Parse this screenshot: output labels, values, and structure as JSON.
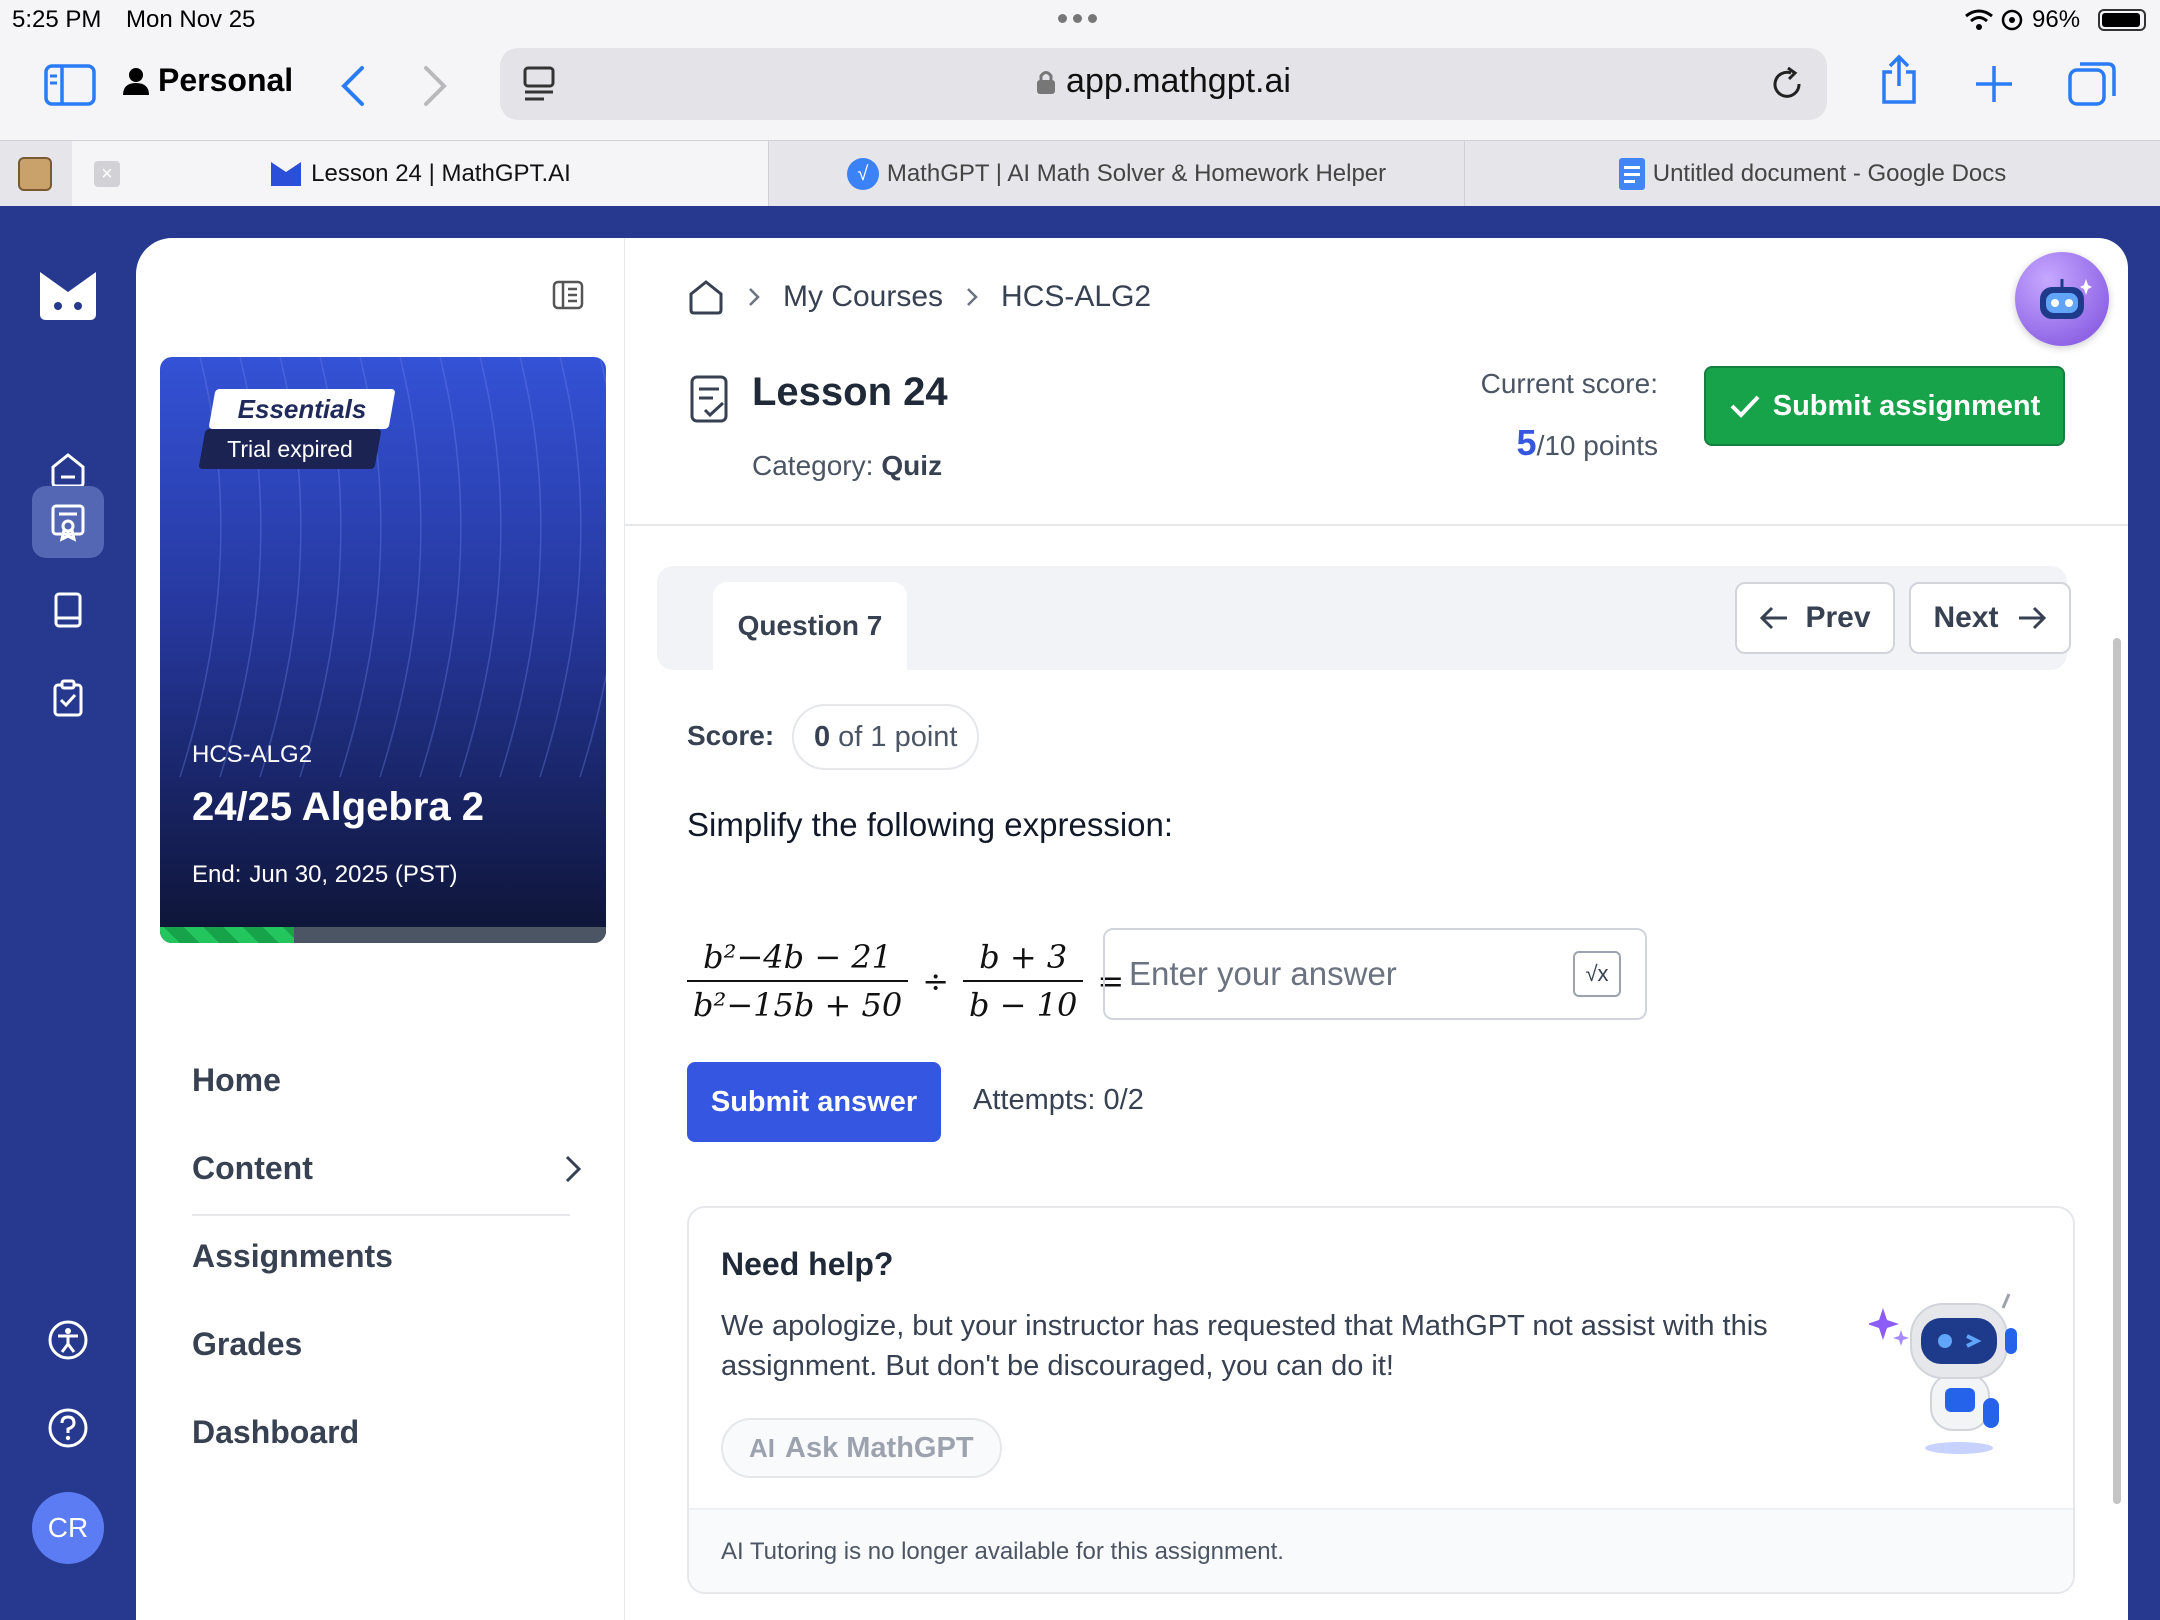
{
  "status_bar": {
    "time": "5:25 PM",
    "date": "Mon Nov 25",
    "battery": "96%"
  },
  "browser": {
    "profile": "Personal",
    "url": "app.mathgpt.ai",
    "tabs": [
      {
        "label": "Lesson 24 | MathGPT.AI",
        "active": true
      },
      {
        "label": "MathGPT | AI Math Solver & Homework Helper",
        "active": false
      },
      {
        "label": "Untitled document - Google Docs",
        "active": false
      }
    ]
  },
  "rail": {
    "avatar_initials": "CR"
  },
  "course_card": {
    "plan": "Essentials",
    "plan_status": "Trial expired",
    "code": "HCS-ALG2",
    "name": "24/25 Algebra 2",
    "end_label": "End:",
    "end_value": "Jun 30, 2025 (PST)",
    "progress": 0.3
  },
  "side_nav": {
    "items": [
      {
        "label": "Home"
      },
      {
        "label": "Content"
      },
      {
        "label": "Assignments"
      },
      {
        "label": "Grades"
      },
      {
        "label": "Dashboard"
      }
    ]
  },
  "breadcrumb": {
    "item1": "My Courses",
    "item2": "HCS-ALG2"
  },
  "lesson": {
    "title": "Lesson 24",
    "category_label": "Category:",
    "category_value": "Quiz",
    "score_label": "Current score:",
    "score_value": "5",
    "score_total": "/10 points",
    "submit_assignment": "Submit assignment"
  },
  "question": {
    "tab_label": "Question 7",
    "prev": "Prev",
    "next": "Next",
    "score_label": "Score:",
    "score_value": "0",
    "score_rest": "of 1 point",
    "prompt": "Simplify the following expression:",
    "expr": {
      "num1": "b²−4b − 21",
      "den1": "b²−15b + 50",
      "op": "÷",
      "num2": "b + 3",
      "den2": "b − 10",
      "eq": "="
    },
    "answer_placeholder": "Enter your answer",
    "math_button": "√x",
    "submit_answer": "Submit answer",
    "attempts": "Attempts: 0/2"
  },
  "help": {
    "title": "Need help?",
    "message": "We apologize, but your instructor has requested that MathGPT not assist with this assignment. But don't be discouraged, you can do it!",
    "ask_button": "Ask MathGPT",
    "ask_icon_text": "AI",
    "footer": "AI Tutoring is no longer available for this assignment."
  },
  "colors": {
    "brand": "#26398e",
    "primary": "#3556e0",
    "success": "#16a34a",
    "score": "#3556e0"
  }
}
